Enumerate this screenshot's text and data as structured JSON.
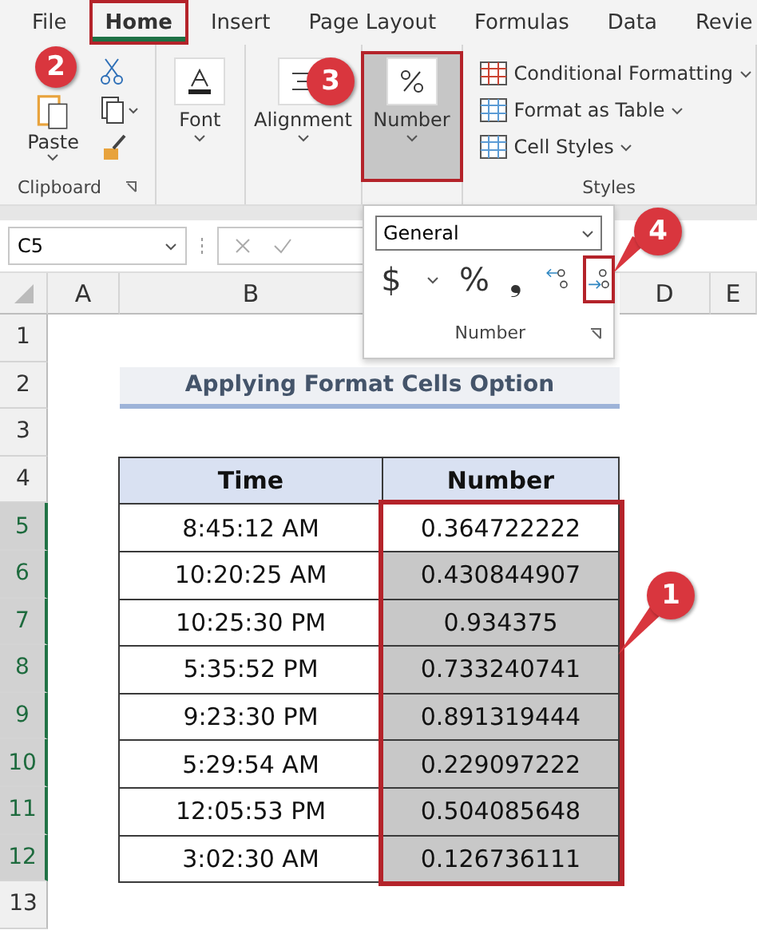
{
  "tabs": [
    {
      "label": "File",
      "selected": false,
      "highlighted": false
    },
    {
      "label": "Home",
      "selected": true,
      "highlighted": true
    },
    {
      "label": "Insert",
      "selected": false,
      "highlighted": false
    },
    {
      "label": "Page Layout",
      "selected": false,
      "highlighted": false
    },
    {
      "label": "Formulas",
      "selected": false,
      "highlighted": false
    },
    {
      "label": "Data",
      "selected": false,
      "highlighted": false
    },
    {
      "label": "Revie",
      "selected": false,
      "highlighted": false
    }
  ],
  "ribbon": {
    "clipboard": {
      "paste": "Paste",
      "label": "Clipboard"
    },
    "groups": [
      {
        "kind": "font",
        "label": "Font",
        "highlighted": false,
        "pressed": false
      },
      {
        "kind": "align",
        "label": "Alignment",
        "highlighted": false,
        "pressed": false
      },
      {
        "kind": "number",
        "label": "Number",
        "highlighted": true,
        "pressed": true
      }
    ],
    "styles": {
      "items": [
        "Conditional Formatting",
        "Format as Table",
        "Cell Styles"
      ],
      "label": "Styles"
    }
  },
  "formula_bar": {
    "name_box": "C5"
  },
  "number_panel": {
    "format": "General",
    "buttons": [
      {
        "kind": "text",
        "label": "$",
        "highlighted": false
      },
      {
        "kind": "caret",
        "highlighted": false
      },
      {
        "kind": "text",
        "label": "%",
        "highlighted": false
      },
      {
        "kind": "text",
        "label": "❟",
        "highlighted": false
      },
      {
        "kind": "decrease",
        "highlighted": false
      },
      {
        "kind": "increase",
        "highlighted": true
      }
    ],
    "label": "Number"
  },
  "sheet": {
    "columns": [
      "A",
      "B",
      "D",
      "E"
    ],
    "row_numbers": [
      {
        "label": "1",
        "selected": false
      },
      {
        "label": "2",
        "selected": false
      },
      {
        "label": "3",
        "selected": false
      },
      {
        "label": "4",
        "selected": false
      },
      {
        "label": "5",
        "selected": true
      },
      {
        "label": "6",
        "selected": true
      },
      {
        "label": "7",
        "selected": true
      },
      {
        "label": "8",
        "selected": true
      },
      {
        "label": "9",
        "selected": true
      },
      {
        "label": "10",
        "selected": true
      },
      {
        "label": "11",
        "selected": true
      },
      {
        "label": "12",
        "selected": true
      },
      {
        "label": "13",
        "selected": false
      }
    ],
    "title": "Applying Format Cells Option",
    "table": {
      "columns": [
        "Time",
        "Number"
      ],
      "rows": [
        {
          "time": "8:45:12 AM",
          "number": "0.364722222",
          "selected": false
        },
        {
          "time": "10:20:25 AM",
          "number": "0.430844907",
          "selected": true
        },
        {
          "time": "10:25:30 PM",
          "number": "0.934375",
          "selected": true
        },
        {
          "time": "5:35:52 PM",
          "number": "0.733240741",
          "selected": true
        },
        {
          "time": "9:23:30 PM",
          "number": "0.891319444",
          "selected": true
        },
        {
          "time": "5:29:54 AM",
          "number": "0.229097222",
          "selected": true
        },
        {
          "time": "12:05:53 PM",
          "number": "0.504085648",
          "selected": true
        },
        {
          "time": "3:02:30 AM",
          "number": "0.126736111",
          "selected": true
        }
      ]
    }
  },
  "callouts": [
    "1",
    "2",
    "3",
    "4"
  ]
}
